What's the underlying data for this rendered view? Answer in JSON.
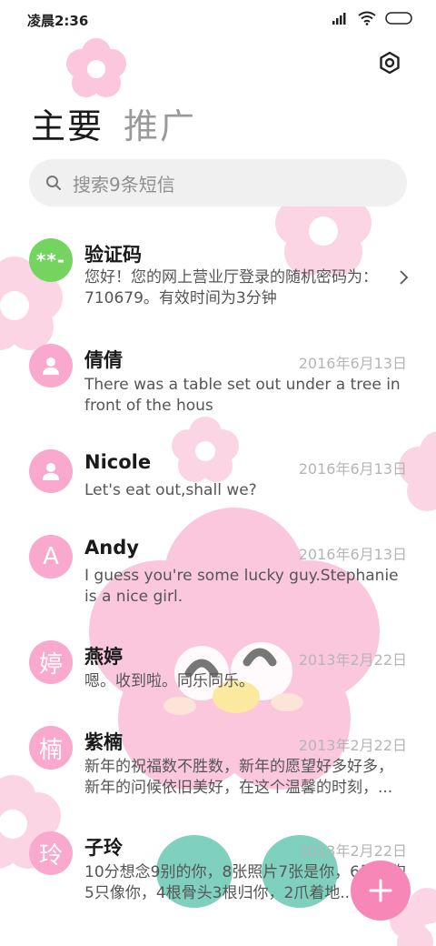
{
  "status_bar": {
    "time": "凌晨2:36"
  },
  "tabs": [
    {
      "label": "主要",
      "active": true
    },
    {
      "label": "推广",
      "active": false
    }
  ],
  "search": {
    "placeholder": "搜索9条短信"
  },
  "messages": [
    {
      "avatar": "**-",
      "avatar_color": "#73d45f",
      "name": "验证码",
      "date": "",
      "preview": "您好！您的网上营业厅登录的随机密码为：710679。有效时间为3分钟",
      "has_chevron": true
    },
    {
      "avatar": "person-icon",
      "name": "倩倩",
      "date": "2016年6月13日",
      "preview": "There was a table set out under a tree in front of the hous"
    },
    {
      "avatar": "person-icon",
      "name": "Nicole",
      "date": "2016年6月13日",
      "preview": "Let's eat out,shall we?"
    },
    {
      "avatar": "A",
      "name": "Andy",
      "date": "2016年6月13日",
      "preview": "I guess you're some lucky guy.Stephanie is a nice girl."
    },
    {
      "avatar": "婷",
      "name": "燕婷",
      "date": "2013年2月22日",
      "preview": "嗯。收到啦。同乐同乐。"
    },
    {
      "avatar": "楠",
      "name": "紫楠",
      "date": "2013年2月22日",
      "preview": "新年的祝福数不胜数，新年的愿望好多好多，新年的问候依旧美好，在这个温馨的时刻，..."
    },
    {
      "avatar": "玲",
      "name": "子玲",
      "date": "2013年2月22日",
      "preview": "10分想念9别的你，8张照片7张是你，6只小狗5只像你，4根骨头3根归你，2爪着地..."
    }
  ],
  "colors": {
    "accent": "#f787b6",
    "avatar_pink": "#f8a9cd",
    "flower_pink": "#fbd3e3"
  }
}
